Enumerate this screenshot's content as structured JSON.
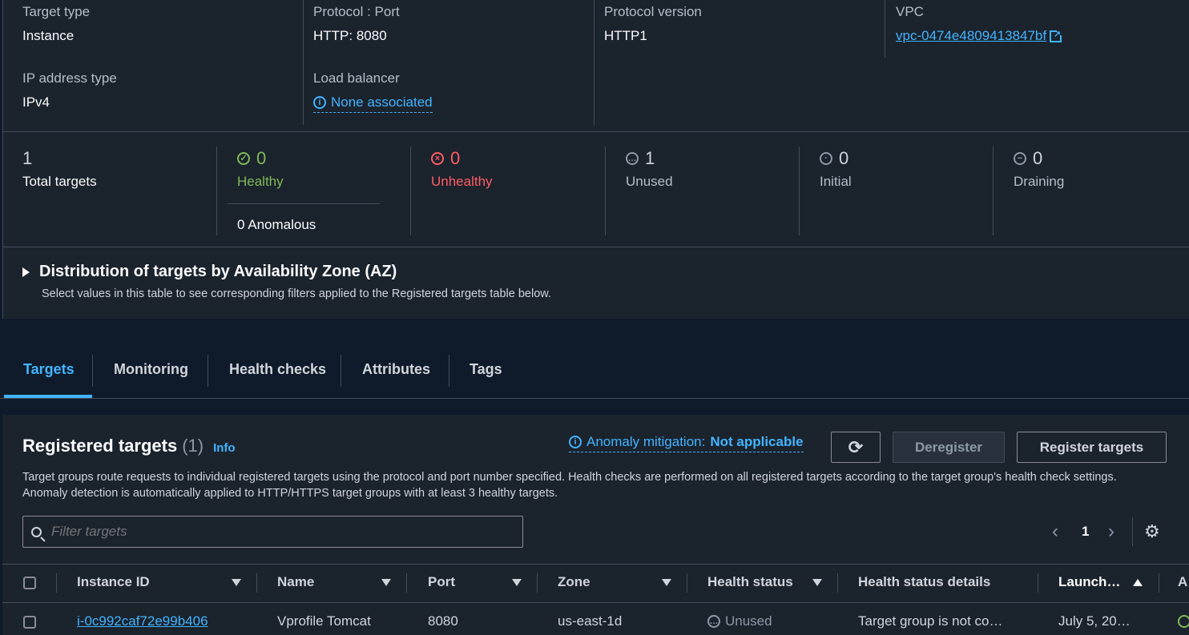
{
  "details": {
    "target_type_label": "Target type",
    "target_type_value": "Instance",
    "protocol_port_label": "Protocol : Port",
    "protocol_port_value": "HTTP: 8080",
    "protocol_version_label": "Protocol version",
    "protocol_version_value": "HTTP1",
    "vpc_label": "VPC",
    "vpc_value": "vpc-0474e4809413847bf",
    "ip_type_label": "IP address type",
    "ip_type_value": "IPv4",
    "load_balancer_label": "Load balancer",
    "load_balancer_value": "None associated"
  },
  "stats": {
    "total_value": "1",
    "total_label": "Total targets",
    "healthy_value": "0",
    "healthy_label": "Healthy",
    "anomalous_label": "0 Anomalous",
    "unhealthy_value": "0",
    "unhealthy_label": "Unhealthy",
    "unused_value": "1",
    "unused_label": "Unused",
    "initial_value": "0",
    "initial_label": "Initial",
    "draining_value": "0",
    "draining_label": "Draining"
  },
  "distribution": {
    "title": "Distribution of targets by Availability Zone (AZ)",
    "subtitle": "Select values in this table to see corresponding filters applied to the Registered targets table below."
  },
  "tabs": [
    "Targets",
    "Monitoring",
    "Health checks",
    "Attributes",
    "Tags"
  ],
  "registered": {
    "title": "Registered targets",
    "count": "(1)",
    "info": "Info",
    "anomaly_label": "Anomaly mitigation:",
    "anomaly_value": "Not applicable",
    "deregister": "Deregister",
    "register": "Register targets",
    "description": "Target groups route requests to individual registered targets using the protocol and port number specified. Health checks are performed on all registered targets according to the target group's health check settings. Anomaly detection is automatically applied to HTTP/HTTPS target groups with at least 3 healthy targets.",
    "filter_placeholder": "Filter targets",
    "page": "1"
  },
  "table": {
    "headers": [
      "Instance ID",
      "Name",
      "Port",
      "Zone",
      "Health status",
      "Health status details",
      "Launch…",
      "A"
    ],
    "rows": [
      {
        "instance_id": "i-0c992caf72e99b406",
        "name": "Vprofile Tomcat",
        "port": "8080",
        "zone": "us-east-1d",
        "health_status": "Unused",
        "health_details": "Target group is not co…",
        "launch": "July 5, 20…"
      }
    ]
  },
  "colors": {
    "healthy": "#7fbb57",
    "unhealthy": "#ff5d64",
    "link": "#42b4ff",
    "accent_tab": "#42b4ff"
  }
}
